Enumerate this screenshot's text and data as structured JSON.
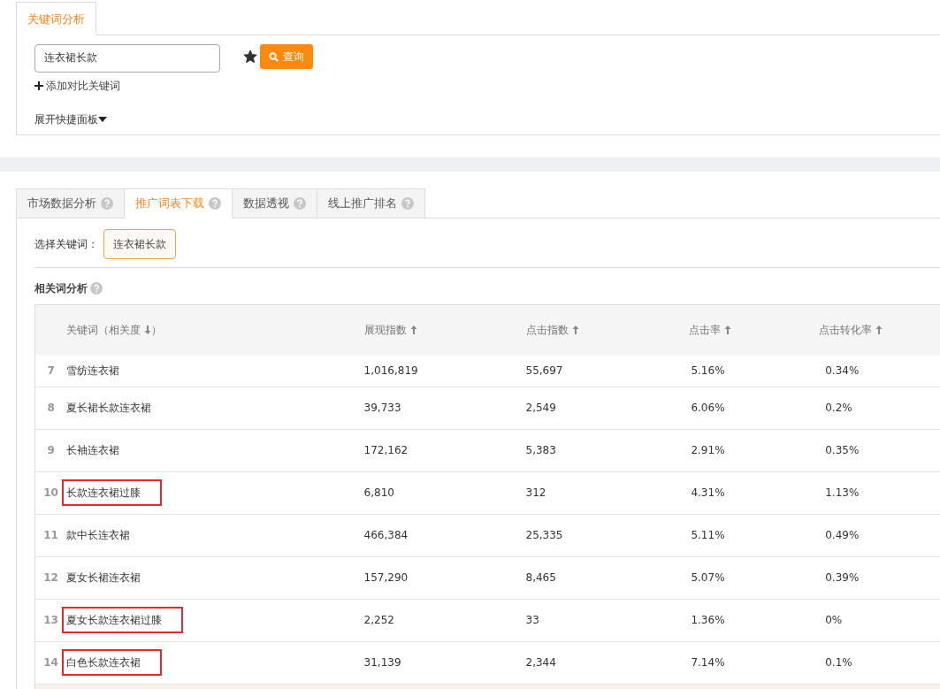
{
  "top_tab": {
    "label": "关键词分析",
    "selected": true
  },
  "search": {
    "value": "连衣裙长款",
    "favorite": true,
    "button": "查询"
  },
  "add_compare": "添加对比关键词",
  "expand_panel": "展开快捷面板",
  "tabs": [
    {
      "label": "市场数据分析",
      "selected": false
    },
    {
      "label": "推广词表下载",
      "selected": true
    },
    {
      "label": "数据透视",
      "selected": false
    },
    {
      "label": "线上推广排名",
      "selected": false
    }
  ],
  "select_label": "选择关键词：",
  "keyword_chips": [
    {
      "label": "连衣裙长款",
      "selected": true
    }
  ],
  "section_title": "相关词分析",
  "table": {
    "columns": [
      {
        "label": "关键词（相关度",
        "descending": true,
        "suffix": "）"
      },
      {
        "label": "展现指数",
        "descending": false
      },
      {
        "label": "点击指数",
        "descending": false
      },
      {
        "label": "点击率",
        "descending": false
      },
      {
        "label": "点击转化率",
        "descending": false
      }
    ],
    "rows": [
      {
        "rank": "7",
        "keyword": "雪纺连衣裙",
        "impressions": "1,016,819",
        "clicks": "55,697",
        "ctr": "5.16%",
        "conversion": "0.34%",
        "highlighted": false
      },
      {
        "rank": "8",
        "keyword": "夏长裙长款连衣裙",
        "impressions": "39,733",
        "clicks": "2,549",
        "ctr": "6.06%",
        "conversion": "0.2%",
        "highlighted": false
      },
      {
        "rank": "9",
        "keyword": "长袖连衣裙",
        "impressions": "172,162",
        "clicks": "5,383",
        "ctr": "2.91%",
        "conversion": "0.35%",
        "highlighted": false
      },
      {
        "rank": "10",
        "keyword": "长款连衣裙过膝",
        "impressions": "6,810",
        "clicks": "312",
        "ctr": "4.31%",
        "conversion": "1.13%",
        "highlighted": true
      },
      {
        "rank": "11",
        "keyword": "款中长连衣裙",
        "impressions": "466,384",
        "clicks": "25,335",
        "ctr": "5.11%",
        "conversion": "0.49%",
        "highlighted": false
      },
      {
        "rank": "12",
        "keyword": "夏女长裙连衣裙",
        "impressions": "157,290",
        "clicks": "8,465",
        "ctr": "5.07%",
        "conversion": "0.39%",
        "highlighted": false
      },
      {
        "rank": "13",
        "keyword": "夏女长款连衣裙过膝",
        "impressions": "2,252",
        "clicks": "33",
        "ctr": "1.36%",
        "conversion": "0%",
        "highlighted": true
      },
      {
        "rank": "14",
        "keyword": "白色长款连衣裙",
        "impressions": "31,139",
        "clicks": "2,344",
        "ctr": "7.14%",
        "conversion": "0.1%",
        "highlighted": true
      }
    ]
  }
}
